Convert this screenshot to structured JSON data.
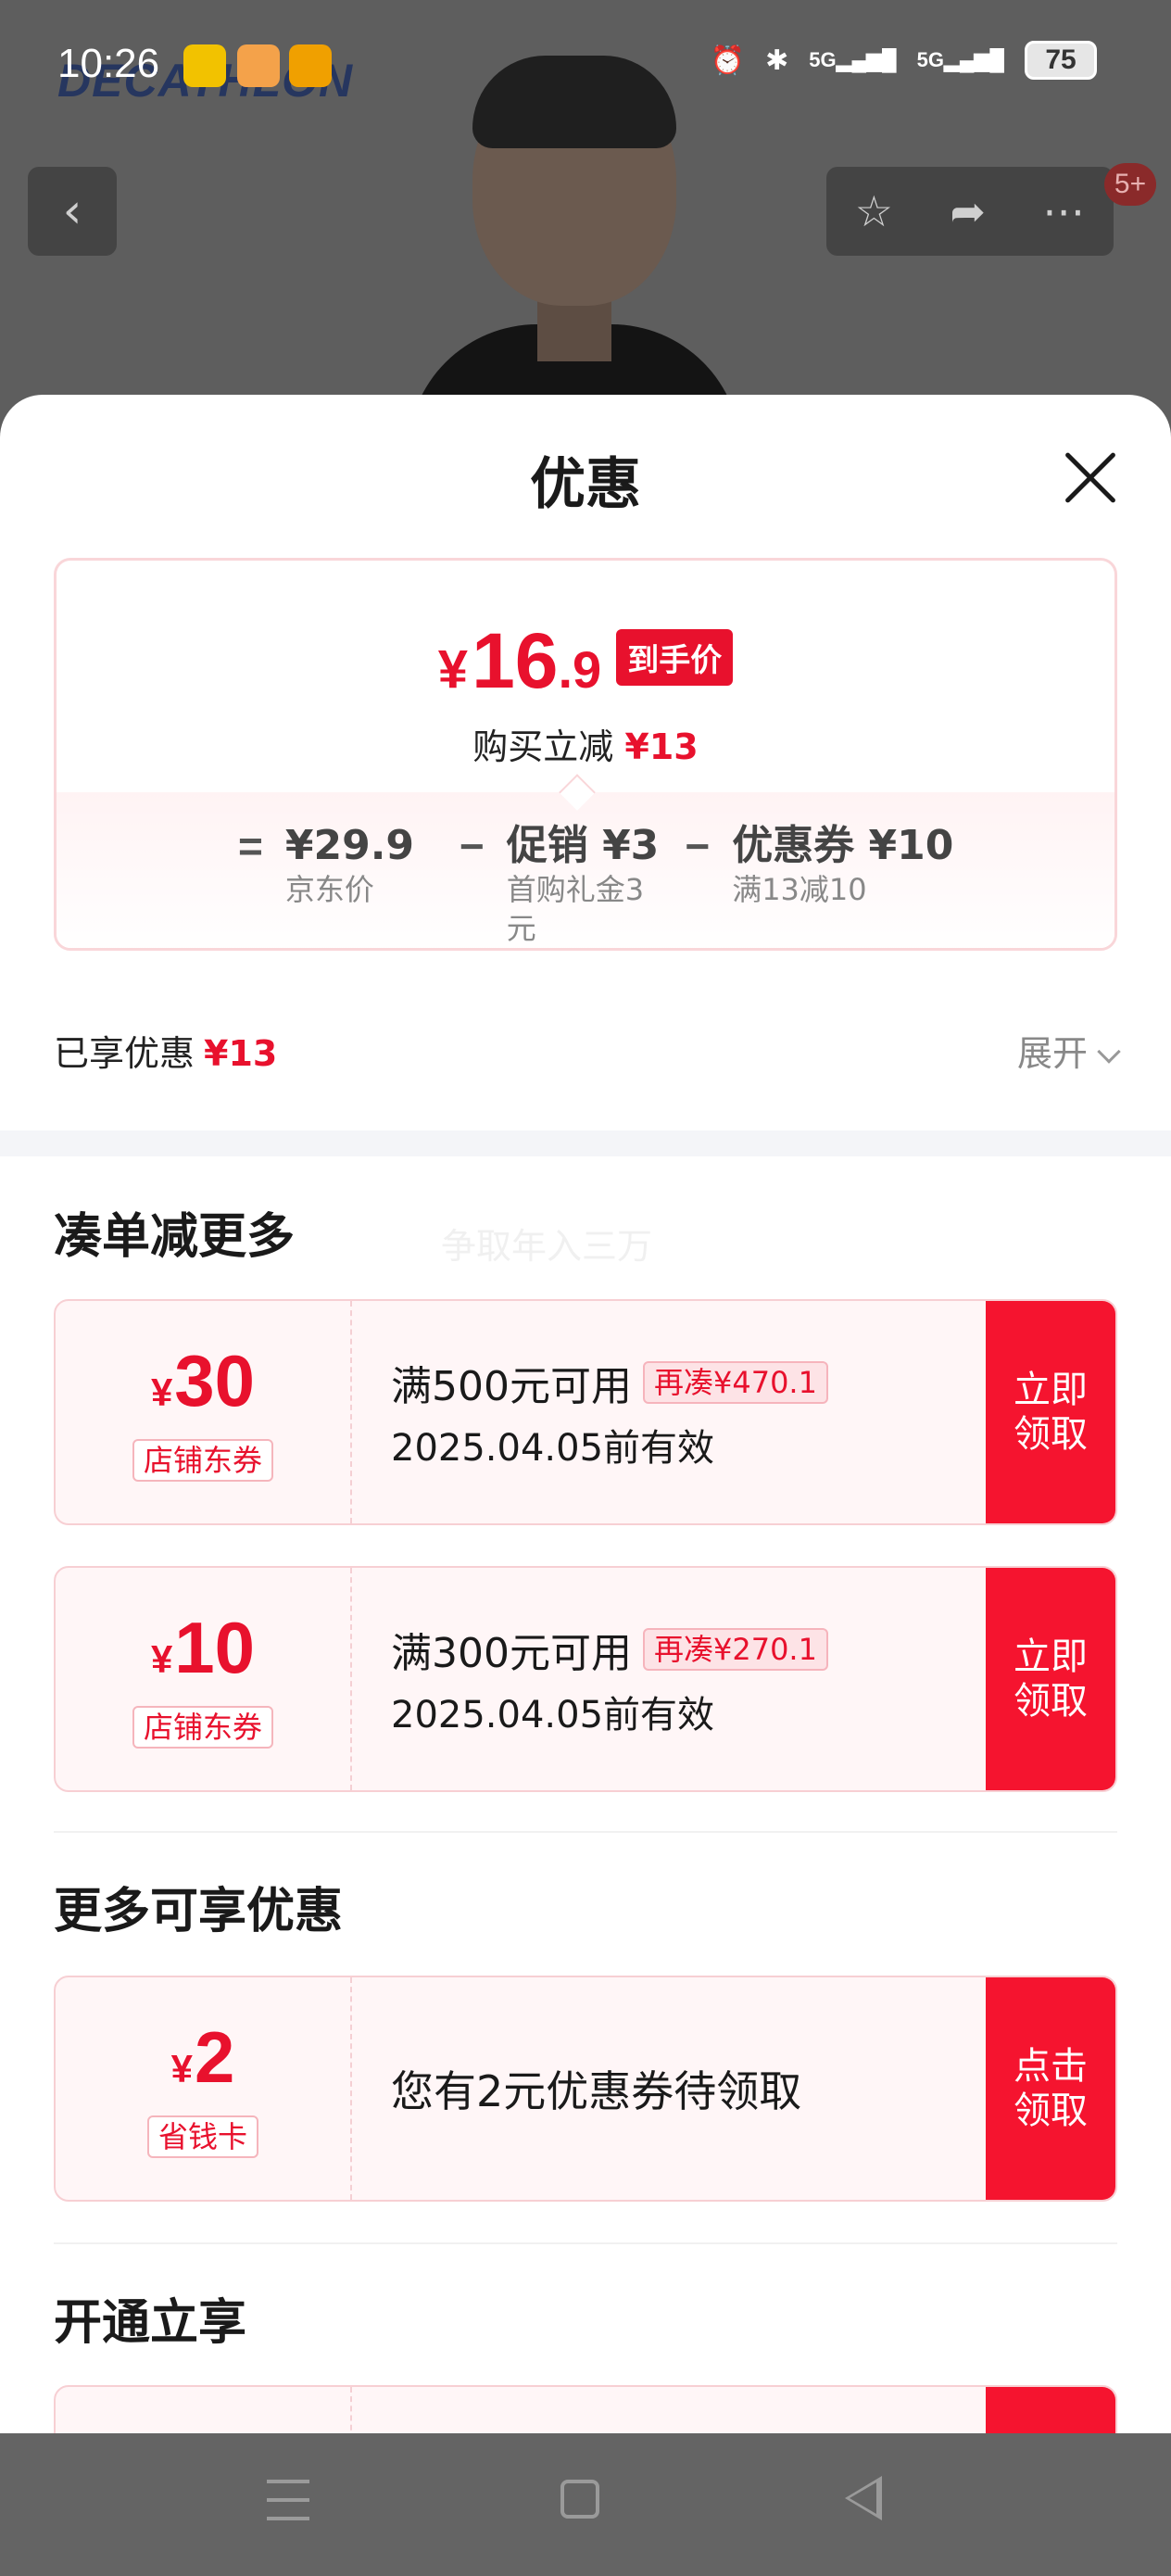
{
  "status_bar": {
    "time": "10:26",
    "network": "5G",
    "network2": "5G",
    "battery": "75"
  },
  "background_page": {
    "brand": "DECATHLON",
    "badge": "5+"
  },
  "sheet": {
    "title": "优惠",
    "final_price": {
      "currency": "¥",
      "integer": "16",
      "decimal": ".9",
      "tag": "到手价"
    },
    "reduce_label": "购买立减",
    "reduce_amount": "¥13",
    "formula": [
      {
        "op": "=",
        "value": "¥29.9",
        "sub": "京东价"
      },
      {
        "op": "−",
        "value": "促销 ¥3",
        "sub": "首购礼金3元"
      },
      {
        "op": "−",
        "value": "优惠券 ¥10",
        "sub": "满13减10"
      }
    ],
    "enjoyed_label": "已享优惠",
    "enjoyed_amount": "¥13",
    "expand_label": "展开",
    "section1_title": "凑单减更多",
    "watermark": "争取年入三万",
    "coupons": [
      {
        "currency": "¥",
        "amount": "30",
        "type": "店铺东券",
        "condition": "满500元可用",
        "more": "再凑¥470.1",
        "valid": "2025.04.05前有效",
        "button": "立即领取"
      },
      {
        "currency": "¥",
        "amount": "10",
        "type": "店铺东券",
        "condition": "满300元可用",
        "more": "再凑¥270.1",
        "valid": "2025.04.05前有效",
        "button": "立即领取"
      }
    ],
    "section2_title": "更多可享优惠",
    "saving_card": {
      "currency": "¥",
      "amount": "2",
      "type": "省钱卡",
      "text": "您有2元优惠券待领取",
      "button": "点击领取"
    },
    "section3_title": "开通立享"
  },
  "colors": {
    "accent": "#e8112d",
    "coupon_bg": "#fff6f7",
    "button_red": "#f5142f"
  }
}
